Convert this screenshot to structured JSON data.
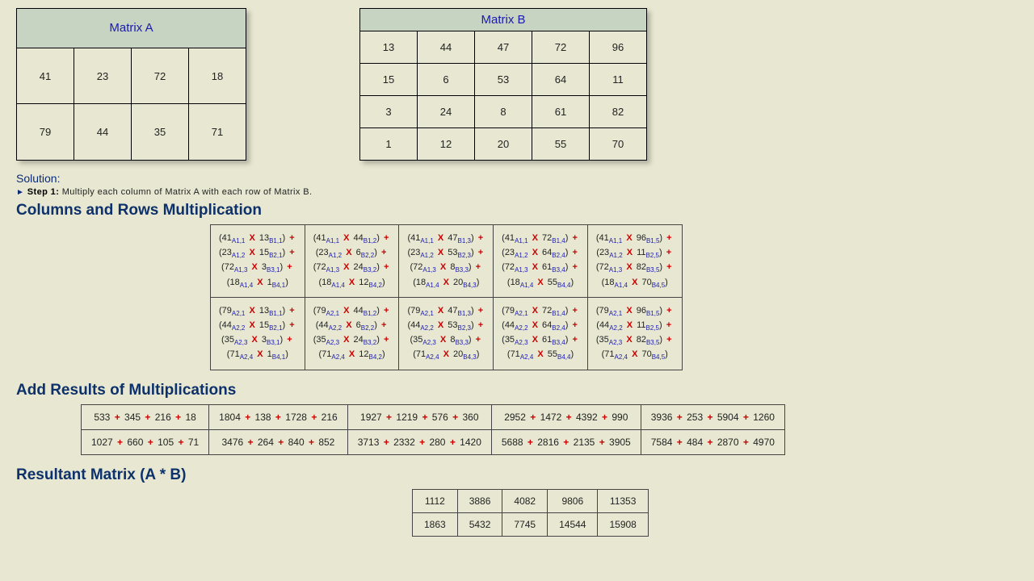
{
  "matrixA": {
    "title": "Matrix A",
    "rows": [
      [
        41,
        23,
        72,
        18
      ],
      [
        79,
        44,
        35,
        71
      ]
    ]
  },
  "matrixB": {
    "title": "Matrix B",
    "rows": [
      [
        13,
        44,
        47,
        72,
        96
      ],
      [
        15,
        6,
        53,
        64,
        11
      ],
      [
        3,
        24,
        8,
        61,
        82
      ],
      [
        1,
        12,
        20,
        55,
        70
      ]
    ]
  },
  "solution_label": "Solution:",
  "step1": {
    "label": "Step 1:",
    "text": " Multiply each column of Matrix A with each row of Matrix B."
  },
  "headings": {
    "mult": "Columns and Rows Multiplication",
    "add": "Add Results of Multiplications",
    "res": "Resultant Matrix (A * B)"
  },
  "mult_table": [
    [
      [
        {
          "a": 41,
          "as": "A1,1",
          "b": 13,
          "bs": "B1,1"
        },
        {
          "a": 23,
          "as": "A1,2",
          "b": 15,
          "bs": "B2,1"
        },
        {
          "a": 72,
          "as": "A1,3",
          "b": 3,
          "bs": "B3,1"
        },
        {
          "a": 18,
          "as": "A1,4",
          "b": 1,
          "bs": "B4,1"
        }
      ],
      [
        {
          "a": 41,
          "as": "A1,1",
          "b": 44,
          "bs": "B1,2"
        },
        {
          "a": 23,
          "as": "A1,2",
          "b": 6,
          "bs": "B2,2"
        },
        {
          "a": 72,
          "as": "A1,3",
          "b": 24,
          "bs": "B3,2"
        },
        {
          "a": 18,
          "as": "A1,4",
          "b": 12,
          "bs": "B4,2"
        }
      ],
      [
        {
          "a": 41,
          "as": "A1,1",
          "b": 47,
          "bs": "B1,3"
        },
        {
          "a": 23,
          "as": "A1,2",
          "b": 53,
          "bs": "B2,3"
        },
        {
          "a": 72,
          "as": "A1,3",
          "b": 8,
          "bs": "B3,3"
        },
        {
          "a": 18,
          "as": "A1,4",
          "b": 20,
          "bs": "B4,3"
        }
      ],
      [
        {
          "a": 41,
          "as": "A1,1",
          "b": 72,
          "bs": "B1,4"
        },
        {
          "a": 23,
          "as": "A1,2",
          "b": 64,
          "bs": "B2,4"
        },
        {
          "a": 72,
          "as": "A1,3",
          "b": 61,
          "bs": "B3,4"
        },
        {
          "a": 18,
          "as": "A1,4",
          "b": 55,
          "bs": "B4,4"
        }
      ],
      [
        {
          "a": 41,
          "as": "A1,1",
          "b": 96,
          "bs": "B1,5"
        },
        {
          "a": 23,
          "as": "A1,2",
          "b": 11,
          "bs": "B2,5"
        },
        {
          "a": 72,
          "as": "A1,3",
          "b": 82,
          "bs": "B3,5"
        },
        {
          "a": 18,
          "as": "A1,4",
          "b": 70,
          "bs": "B4,5"
        }
      ]
    ],
    [
      [
        {
          "a": 79,
          "as": "A2,1",
          "b": 13,
          "bs": "B1,1"
        },
        {
          "a": 44,
          "as": "A2,2",
          "b": 15,
          "bs": "B2,1"
        },
        {
          "a": 35,
          "as": "A2,3",
          "b": 3,
          "bs": "B3,1"
        },
        {
          "a": 71,
          "as": "A2,4",
          "b": 1,
          "bs": "B4,1"
        }
      ],
      [
        {
          "a": 79,
          "as": "A2,1",
          "b": 44,
          "bs": "B1,2"
        },
        {
          "a": 44,
          "as": "A2,2",
          "b": 6,
          "bs": "B2,2"
        },
        {
          "a": 35,
          "as": "A2,3",
          "b": 24,
          "bs": "B3,2"
        },
        {
          "a": 71,
          "as": "A2,4",
          "b": 12,
          "bs": "B4,2"
        }
      ],
      [
        {
          "a": 79,
          "as": "A2,1",
          "b": 47,
          "bs": "B1,3"
        },
        {
          "a": 44,
          "as": "A2,2",
          "b": 53,
          "bs": "B2,3"
        },
        {
          "a": 35,
          "as": "A2,3",
          "b": 8,
          "bs": "B3,3"
        },
        {
          "a": 71,
          "as": "A2,4",
          "b": 20,
          "bs": "B4,3"
        }
      ],
      [
        {
          "a": 79,
          "as": "A2,1",
          "b": 72,
          "bs": "B1,4"
        },
        {
          "a": 44,
          "as": "A2,2",
          "b": 64,
          "bs": "B2,4"
        },
        {
          "a": 35,
          "as": "A2,3",
          "b": 61,
          "bs": "B3,4"
        },
        {
          "a": 71,
          "as": "A2,4",
          "b": 55,
          "bs": "B4,4"
        }
      ],
      [
        {
          "a": 79,
          "as": "A2,1",
          "b": 96,
          "bs": "B1,5"
        },
        {
          "a": 44,
          "as": "A2,2",
          "b": 11,
          "bs": "B2,5"
        },
        {
          "a": 35,
          "as": "A2,3",
          "b": 82,
          "bs": "B3,5"
        },
        {
          "a": 71,
          "as": "A2,4",
          "b": 70,
          "bs": "B4,5"
        }
      ]
    ]
  ],
  "sums_table": [
    [
      [
        533,
        345,
        216,
        18
      ],
      [
        1804,
        138,
        1728,
        216
      ],
      [
        1927,
        1219,
        576,
        360
      ],
      [
        2952,
        1472,
        4392,
        990
      ],
      [
        3936,
        253,
        5904,
        1260
      ]
    ],
    [
      [
        1027,
        660,
        105,
        71
      ],
      [
        3476,
        264,
        840,
        852
      ],
      [
        3713,
        2332,
        280,
        1420
      ],
      [
        5688,
        2816,
        2135,
        3905
      ],
      [
        7584,
        484,
        2870,
        4970
      ]
    ]
  ],
  "result": [
    [
      1112,
      3886,
      4082,
      9806,
      11353
    ],
    [
      1863,
      5432,
      7745,
      14544,
      15908
    ]
  ]
}
